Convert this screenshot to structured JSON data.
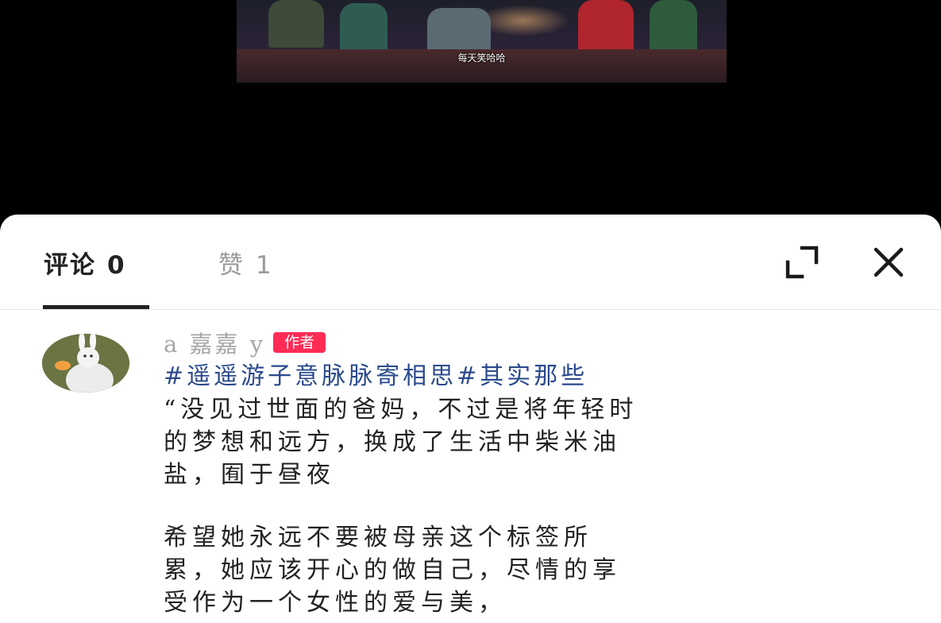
{
  "video": {
    "subtitle": "每天笑哈哈"
  },
  "comments_panel": {
    "tabs": [
      {
        "label": "评论",
        "count": "0",
        "active": true
      },
      {
        "label": "赞",
        "count": "1",
        "active": false
      }
    ],
    "icons": {
      "expand": "expand-icon",
      "close": "close-icon"
    },
    "colors": {
      "active_tab": "#222222",
      "inactive_tab": "#9a9a9a",
      "author_badge": "#fe2c55",
      "hashtag": "#2a4a8c"
    }
  },
  "comment": {
    "username": "a 嘉嘉 y",
    "badge": "作者",
    "hashtags": "#遥遥游子意脉脉寄相思#其实那些",
    "paragraph1": [
      "“没见过世面的爸妈，不过是将年轻时",
      "的梦想和远方，换成了生活中柴米油",
      "盐，囿于昼夜"
    ],
    "paragraph2": [
      "希望她永远不要被母亲这个标签所",
      "累，她应该开心的做自己，尽情的享",
      "受作为一个女性的爱与美，"
    ]
  }
}
